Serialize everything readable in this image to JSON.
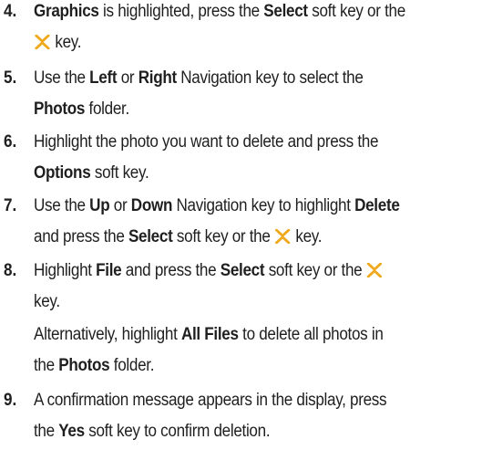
{
  "steps": [
    {
      "number": "4.",
      "lines": [
        [
          {
            "t": "Graphics",
            "b": true
          },
          {
            "t": " is highlighted, press the "
          },
          {
            "t": "Select",
            "b": true
          },
          {
            "t": " soft key or the"
          }
        ],
        [
          {
            "icon": "select-key-icon"
          },
          {
            "t": " key."
          }
        ]
      ]
    },
    {
      "number": "5.",
      "lines": [
        [
          {
            "t": "Use the "
          },
          {
            "t": "Left",
            "b": true
          },
          {
            "t": " or "
          },
          {
            "t": "Right",
            "b": true
          },
          {
            "t": " Navigation key to select the"
          }
        ],
        [
          {
            "t": "Photos",
            "b": true
          },
          {
            "t": " folder."
          }
        ]
      ]
    },
    {
      "number": "6.",
      "lines": [
        [
          {
            "t": "Highlight the photo you want to delete and press the"
          }
        ],
        [
          {
            "t": "Options",
            "b": true
          },
          {
            "t": " soft key."
          }
        ]
      ]
    },
    {
      "number": "7.",
      "lines": [
        [
          {
            "t": "Use the "
          },
          {
            "t": "Up",
            "b": true
          },
          {
            "t": " or "
          },
          {
            "t": "Down",
            "b": true
          },
          {
            "t": " Navigation key to highlight "
          },
          {
            "t": "Delete",
            "b": true
          }
        ],
        [
          {
            "t": "and press the "
          },
          {
            "t": "Select",
            "b": true
          },
          {
            "t": " soft key or the "
          },
          {
            "icon": "select-key-icon"
          },
          {
            "t": " key."
          }
        ]
      ]
    },
    {
      "number": "8.",
      "lines": [
        [
          {
            "t": "Highlight "
          },
          {
            "t": "File",
            "b": true
          },
          {
            "t": " and press the "
          },
          {
            "t": "Select",
            "b": true
          },
          {
            "t": " soft key or the "
          },
          {
            "icon": "select-key-icon"
          }
        ],
        [
          {
            "t": "key."
          }
        ]
      ]
    },
    {
      "number": "",
      "lines": [
        [
          {
            "t": "Alternatively, highlight "
          },
          {
            "t": "All Files",
            "b": true
          },
          {
            "t": " to delete all photos in"
          }
        ],
        [
          {
            "t": "the "
          },
          {
            "t": "Photos",
            "b": true
          },
          {
            "t": " folder."
          }
        ]
      ]
    },
    {
      "number": "9.",
      "lines": [
        [
          {
            "t": "A confirmation message appears in the display, press"
          }
        ],
        [
          {
            "t": "the "
          },
          {
            "t": "Yes",
            "b": true
          },
          {
            "t": " soft key to confirm deletion."
          }
        ]
      ]
    }
  ],
  "colors": {
    "text": "#1f1f1f",
    "icon": "#f0a81c"
  }
}
